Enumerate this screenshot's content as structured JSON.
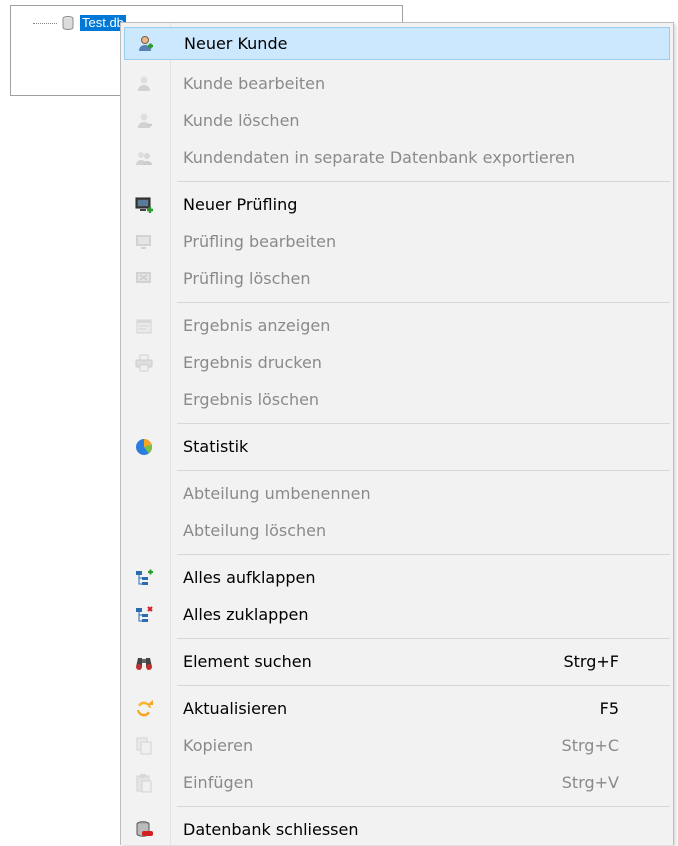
{
  "tree": {
    "root_label": "Test.db"
  },
  "menu": {
    "items": [
      {
        "label": "Neuer Kunde",
        "shortcut": ""
      },
      {
        "label": "Kunde bearbeiten",
        "shortcut": ""
      },
      {
        "label": "Kunde löschen",
        "shortcut": ""
      },
      {
        "label": "Kundendaten in separate Datenbank exportieren",
        "shortcut": ""
      },
      {
        "label": "Neuer Prüfling",
        "shortcut": ""
      },
      {
        "label": "Prüfling bearbeiten",
        "shortcut": ""
      },
      {
        "label": "Prüfling löschen",
        "shortcut": ""
      },
      {
        "label": "Ergebnis anzeigen",
        "shortcut": ""
      },
      {
        "label": "Ergebnis drucken",
        "shortcut": ""
      },
      {
        "label": "Ergebnis löschen",
        "shortcut": ""
      },
      {
        "label": "Statistik",
        "shortcut": ""
      },
      {
        "label": "Abteilung umbenennen",
        "shortcut": ""
      },
      {
        "label": "Abteilung löschen",
        "shortcut": ""
      },
      {
        "label": "Alles aufklappen",
        "shortcut": ""
      },
      {
        "label": "Alles zuklappen",
        "shortcut": ""
      },
      {
        "label": "Element suchen",
        "shortcut": "Strg+F"
      },
      {
        "label": "Aktualisieren",
        "shortcut": "F5"
      },
      {
        "label": "Kopieren",
        "shortcut": "Strg+C"
      },
      {
        "label": "Einfügen",
        "shortcut": "Strg+V"
      },
      {
        "label": "Datenbank schliessen",
        "shortcut": ""
      }
    ]
  },
  "icons": {
    "new_customer": "add-user-icon",
    "edit_customer": "user-icon",
    "delete_customer": "user-delete-icon",
    "export_customer": "users-export-icon",
    "new_device": "monitor-add-icon",
    "edit_device": "monitor-icon",
    "delete_device": "monitor-delete-icon",
    "show_result": "report-icon",
    "print_result": "printer-icon",
    "statistics": "pie-chart-icon",
    "expand_all": "tree-expand-icon",
    "collapse_all": "tree-collapse-icon",
    "find": "binoculars-icon",
    "refresh": "refresh-icon",
    "copy": "copy-icon",
    "paste": "paste-icon",
    "close_db": "database-close-icon"
  },
  "colors": {
    "selection": "#0078d7",
    "highlight": "#cce8ff",
    "highlight_border": "#9acbf0",
    "disabled_text": "#8a8a8a"
  }
}
